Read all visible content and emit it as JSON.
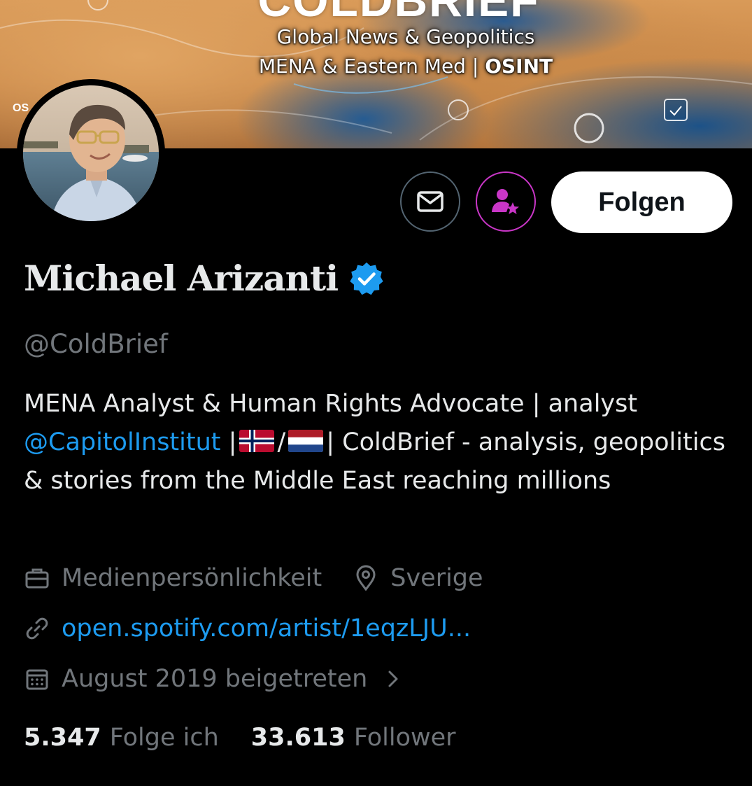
{
  "banner": {
    "logo_text": "COLDBRIEF",
    "line1": "Global News & Geopolitics",
    "line2_prefix": "MENA & Eastern Med | ",
    "line2_bold": "OSINT",
    "corner_text": "OS"
  },
  "actions": {
    "message_icon": "envelope-icon",
    "subscribe_icon": "person-star-icon",
    "follow_label": "Folgen"
  },
  "profile": {
    "display_name": "Michael Arizanti",
    "handle": "@ColdBrief",
    "verified_icon": "verified-badge-icon"
  },
  "bio": {
    "part1": "MENA Analyst & Human Rights Advocate | analyst ",
    "mention": "@CapitolInstitut",
    "part2": " |",
    "flag1": "norway-flag",
    "sep": "/",
    "flag2": "netherlands-flag",
    "part3": "| ColdBrief - analysis, geopolitics & stories from the Middle East reaching millions"
  },
  "meta": {
    "category": "Medienpersönlichkeit",
    "location": "Sverige",
    "website": "open.spotify.com/artist/1eqzLJU...",
    "joined": "August 2019 beigetreten"
  },
  "stats": {
    "following_count": "5.347",
    "following_label": "Folge ich",
    "followers_count": "33.613",
    "followers_label": "Follower"
  },
  "colors": {
    "background": "#000000",
    "text_primary": "#e7e9ea",
    "text_secondary": "#71767b",
    "link": "#1d9bf0",
    "subscribe_accent": "#c936c7",
    "follow_button_bg": "#ffffff"
  }
}
